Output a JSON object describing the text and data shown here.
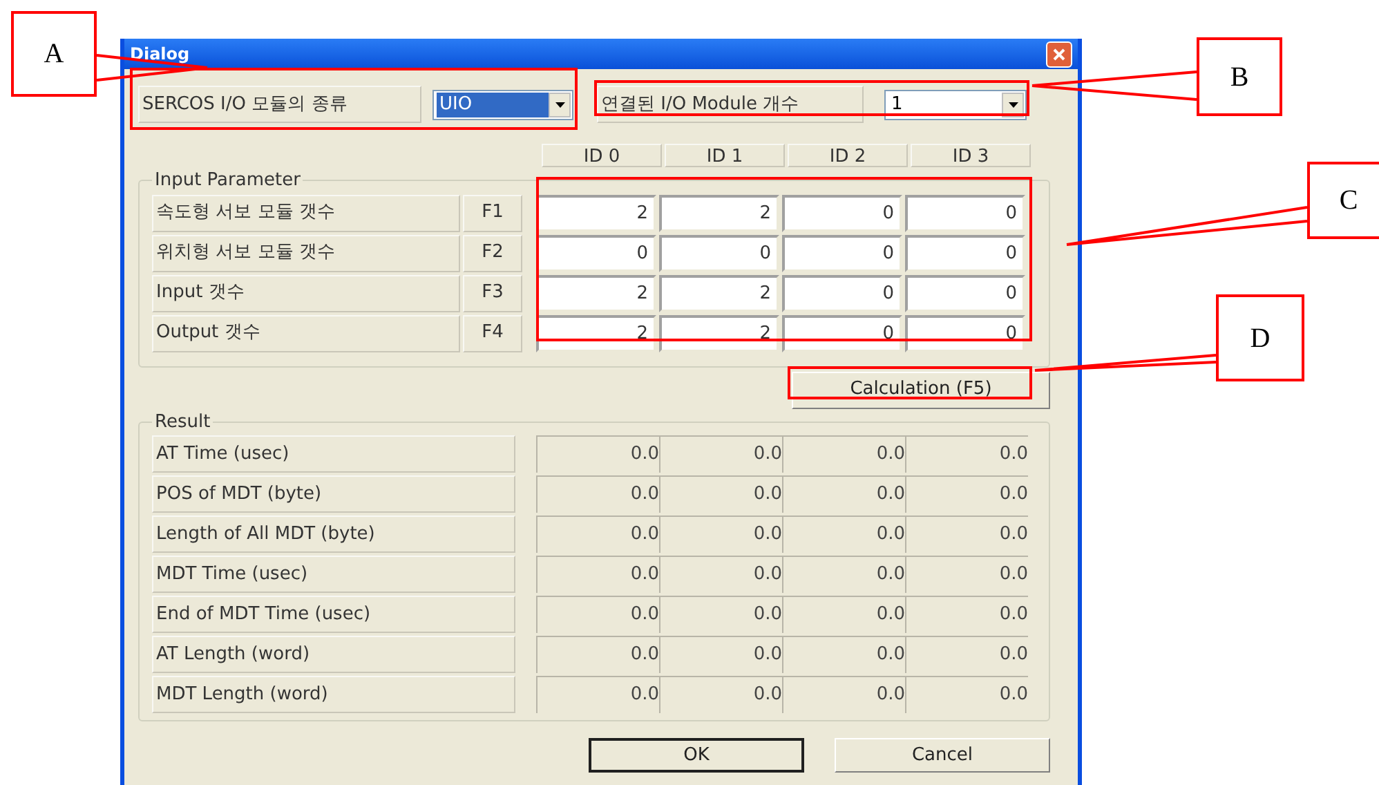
{
  "window": {
    "title": "Dialog"
  },
  "module_type": {
    "label": "SERCOS I/O 모듈의 종류",
    "value": "UIO",
    "focused": true
  },
  "module_count": {
    "label": "연결된 I/O Module 개수",
    "value": "1",
    "focused": false
  },
  "id_columns": [
    "ID 0",
    "ID 1",
    "ID 2",
    "ID 3"
  ],
  "input_parameter": {
    "title": "Input Parameter",
    "rows": [
      {
        "label": "속도형 서보 모듈 갯수",
        "key": "F1",
        "values": [
          "2",
          "2",
          "0",
          "0"
        ]
      },
      {
        "label": "위치형 서보 모듈 갯수",
        "key": "F2",
        "values": [
          "0",
          "0",
          "0",
          "0"
        ]
      },
      {
        "label": "Input 갯수",
        "key": "F3",
        "values": [
          "2",
          "2",
          "0",
          "0"
        ]
      },
      {
        "label": "Output 갯수",
        "key": "F4",
        "values": [
          "2",
          "2",
          "0",
          "0"
        ]
      }
    ]
  },
  "calculation_button": "Calculation (F5)",
  "result": {
    "title": "Result",
    "rows": [
      {
        "label": "AT Time (usec)",
        "values": [
          "0.0",
          "0.0",
          "0.0",
          "0.0"
        ]
      },
      {
        "label": "POS of MDT (byte)",
        "values": [
          "0.0",
          "0.0",
          "0.0",
          "0.0"
        ]
      },
      {
        "label": "Length of All MDT (byte)",
        "values": [
          "0.0",
          "0.0",
          "0.0",
          "0.0"
        ]
      },
      {
        "label": "MDT Time (usec)",
        "values": [
          "0.0",
          "0.0",
          "0.0",
          "0.0"
        ]
      },
      {
        "label": "End of MDT Time (usec)",
        "values": [
          "0.0",
          "0.0",
          "0.0",
          "0.0"
        ]
      },
      {
        "label": "AT Length (word)",
        "values": [
          "0.0",
          "0.0",
          "0.0",
          "0.0"
        ]
      },
      {
        "label": "MDT Length (word)",
        "values": [
          "0.0",
          "0.0",
          "0.0",
          "0.0"
        ]
      }
    ]
  },
  "buttons": [
    "OK",
    "Cancel"
  ],
  "callouts": [
    "A",
    "B",
    "C",
    "D"
  ]
}
